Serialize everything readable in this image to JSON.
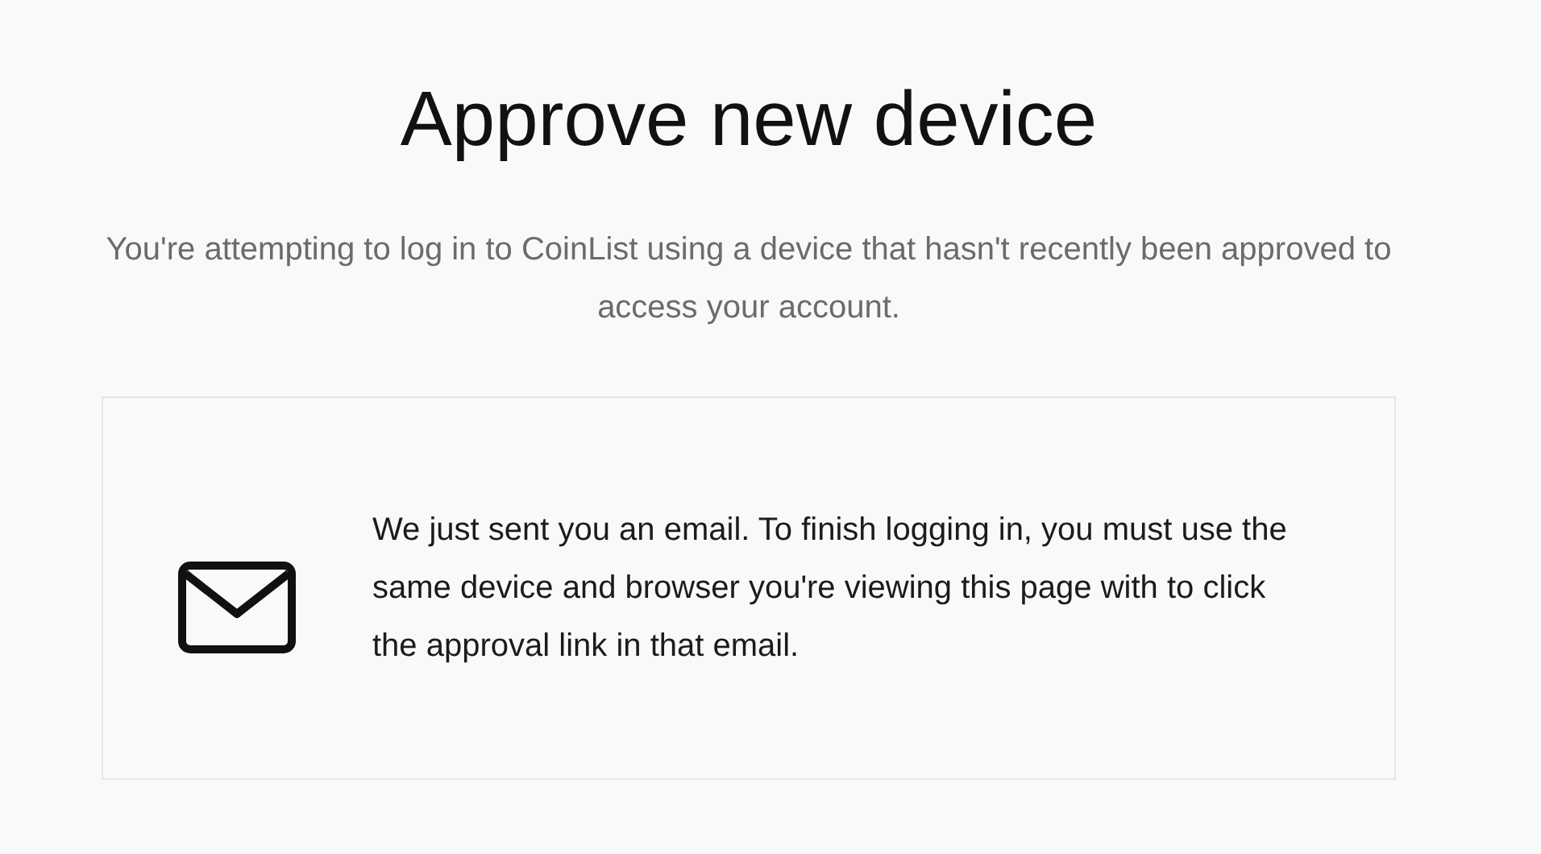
{
  "title": "Approve new device",
  "subtitle": "You're attempting to log in to CoinList using a device that hasn't recently been approved to access your account.",
  "notice": {
    "text": "We just sent you an email. To finish logging in, you must use the same device and browser you're viewing this page with to click the approval link in that email."
  }
}
